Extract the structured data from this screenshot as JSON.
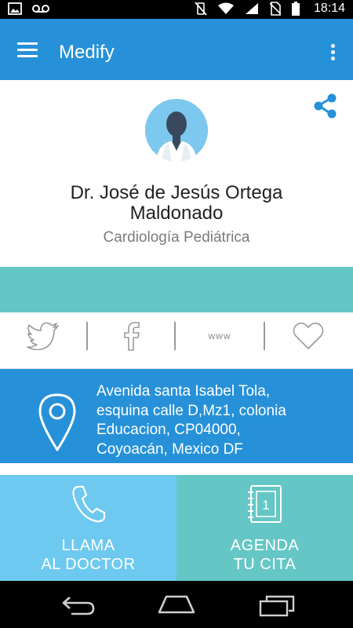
{
  "status_bar": {
    "time": "18:14",
    "icons": [
      "image-icon",
      "voicemail-icon",
      "vibrate-off-icon",
      "wifi-icon",
      "signal-icon",
      "no-sim-icon",
      "battery-icon"
    ]
  },
  "app_bar": {
    "title": "Medify",
    "menu_icon": "hamburger-menu-icon",
    "overflow_icon": "more-vert-icon",
    "color": "#2691d9"
  },
  "profile": {
    "name_line1": "Dr. José de Jesús Ortega",
    "name_line2": "Maldonado",
    "specialty": "Cardiología Pediátrica",
    "avatar_icon": "doctor-avatar-icon",
    "share_icon": "share-icon",
    "accent_color": "#2691d9"
  },
  "social": {
    "twitter_icon": "twitter-icon",
    "facebook_icon": "facebook-icon",
    "website_label": "www",
    "favorite_icon": "heart-icon"
  },
  "address": {
    "icon": "location-pin-icon",
    "lines": [
      "Avenida santa Isabel Tola,",
      "esquina calle D,Mz1, colonia",
      "Educacion, CP04000,",
      "Coyoacán, Mexico DF"
    ]
  },
  "actions": {
    "call": {
      "line1": "LLAMA",
      "line2": "AL DOCTOR",
      "icon": "phone-icon",
      "color": "#6ec9f0"
    },
    "book": {
      "line1": "AGENDA",
      "line2": "TU CITA",
      "icon": "calendar-icon",
      "calendar_number": "1",
      "color": "#65c7c5"
    }
  },
  "nav_bar": {
    "icons": [
      "back-icon",
      "home-icon",
      "recents-icon"
    ]
  }
}
